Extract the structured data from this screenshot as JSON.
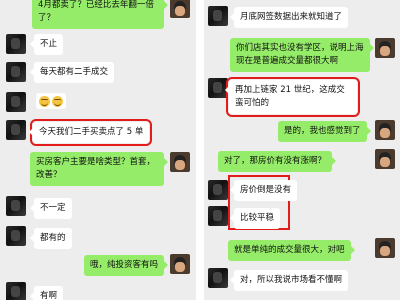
{
  "left_chat": {
    "messages": [
      {
        "text": "4月都卖了？已经比去年翻一倍了？"
      },
      {
        "text": "不止"
      },
      {
        "text": "每天都有二手成交"
      },
      {
        "text": "",
        "emoji": "laughing-emoji"
      },
      {
        "text": "今天我们二手买卖点了 5 单"
      },
      {
        "text": "买房客户主要是啥类型？首套，改善？"
      },
      {
        "text": "不一定"
      },
      {
        "text": "都有的"
      },
      {
        "text": "哦，纯投资客有吗"
      },
      {
        "text": "有啊"
      }
    ]
  },
  "right_chat": {
    "messages": [
      {
        "text": "月底网签数据出来就知道了"
      },
      {
        "text": "你们店其实也没有学区，说明上海现在是普遍成交量都很大啊"
      },
      {
        "text": "再加上链家 21 世纪，这成交蛮可怕的"
      },
      {
        "text": "是的，我也感觉到了"
      },
      {
        "text": "对了，那房价有没有涨啊？"
      },
      {
        "text": "房价倒是没有"
      },
      {
        "text": "比较平稳"
      },
      {
        "text": "就是单纯的成交量很大，对吧"
      },
      {
        "text": "对，所以我说市场看不懂啊"
      }
    ]
  },
  "colors": {
    "received_bubble": "#ffffff",
    "sent_bubble": "#95ec69",
    "highlight": "#e21b1b",
    "background": "#ededed"
  }
}
